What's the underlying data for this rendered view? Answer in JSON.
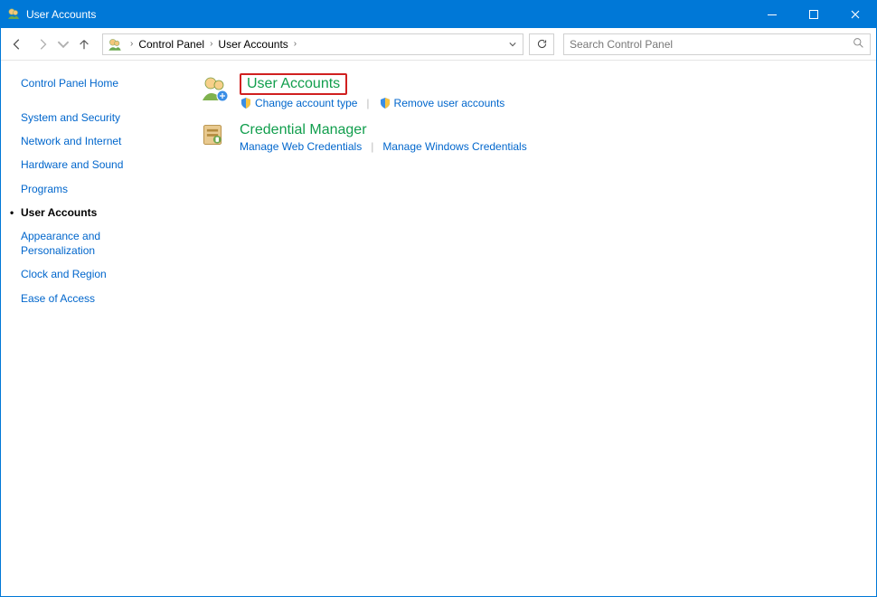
{
  "window": {
    "title": "User Accounts"
  },
  "addressbar": {
    "segments": [
      "Control Panel",
      "User Accounts"
    ]
  },
  "search": {
    "placeholder": "Search Control Panel"
  },
  "sidebar": {
    "home_label": "Control Panel Home",
    "items": [
      "System and Security",
      "Network and Internet",
      "Hardware and Sound",
      "Programs",
      "User Accounts",
      "Appearance and Personalization",
      "Clock and Region",
      "Ease of Access"
    ],
    "active_index": 4
  },
  "content": {
    "sections": [
      {
        "title": "User Accounts",
        "highlighted": true,
        "links": [
          {
            "label": "Change account type",
            "shield": true
          },
          {
            "label": "Remove user accounts",
            "shield": true
          }
        ]
      },
      {
        "title": "Credential Manager",
        "highlighted": false,
        "links": [
          {
            "label": "Manage Web Credentials",
            "shield": false
          },
          {
            "label": "Manage Windows Credentials",
            "shield": false
          }
        ]
      }
    ]
  }
}
